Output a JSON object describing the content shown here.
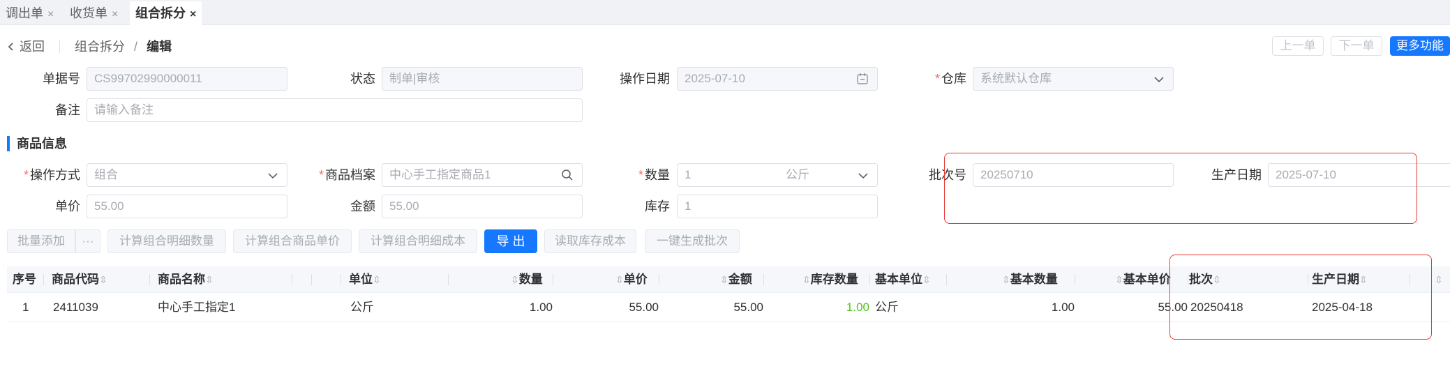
{
  "tabs": [
    {
      "label": "调出单",
      "close": "×"
    },
    {
      "label": "收货单",
      "close": "×"
    },
    {
      "label": "组合拆分",
      "close": "×"
    }
  ],
  "breadcrumb": {
    "back": "返回",
    "back_icon": "chevron-left-icon",
    "parent": "组合拆分",
    "separator": "/",
    "current": "编辑"
  },
  "nav_buttons": {
    "prev": "上一单",
    "next": "下一单",
    "more": "更多功能"
  },
  "form": {
    "doc_no": {
      "label": "单据号",
      "value": "CS99702990000011"
    },
    "status": {
      "label": "状态",
      "value": "制单|审核"
    },
    "op_date": {
      "label": "操作日期",
      "value": "2025-07-10"
    },
    "warehouse": {
      "label": "仓库",
      "value": "系统默认仓库"
    },
    "remark": {
      "label": "备注",
      "placeholder": "请输入备注"
    }
  },
  "section_title": "商品信息",
  "goods": {
    "op_mode": {
      "label": "操作方式",
      "value": "组合"
    },
    "product": {
      "label": "商品档案",
      "value": "中心手工指定商品1"
    },
    "qty": {
      "label": "数量",
      "value": "1",
      "unit": "公斤"
    },
    "batch": {
      "label": "批次号",
      "value": "20250710"
    },
    "prod_date": {
      "label": "生产日期",
      "value": "2025-07-10"
    },
    "price": {
      "label": "单价",
      "value": "55.00"
    },
    "amount": {
      "label": "金额",
      "value": "55.00"
    },
    "stock": {
      "label": "库存",
      "value": "1"
    }
  },
  "toolbar": {
    "batch_add": "批量添加",
    "more": "···",
    "calc_qty": "计算组合明细数量",
    "calc_price": "计算组合商品单价",
    "calc_cost": "计算组合明细成本",
    "export": "导 出",
    "read_cost": "读取库存成本",
    "gen_batch": "一键生成批次"
  },
  "table": {
    "headers": {
      "seq": "序号",
      "code": "商品代码",
      "name": "商品名称",
      "unit": "单位",
      "qty": "数量",
      "price": "单价",
      "amount": "金额",
      "stock_qty": "库存数量",
      "base_unit": "基本单位",
      "base_qty": "基本数量",
      "base_price": "基本单价",
      "batch": "批次",
      "prod_date": "生产日期"
    },
    "rows": [
      {
        "seq": "1",
        "code": "2411039",
        "name": "中心手工指定1",
        "unit": "公斤",
        "qty": "1.00",
        "price": "55.00",
        "amount": "55.00",
        "stock_qty": "1.00",
        "base_unit": "公斤",
        "base_qty": "1.00",
        "base_price": "55.00",
        "batch": "20250418",
        "prod_date": "2025-04-18"
      }
    ]
  },
  "colors": {
    "primary": "#1677ff",
    "required": "#f56c6c",
    "highlight": "#e53935",
    "stock_green": "#52c41a"
  }
}
